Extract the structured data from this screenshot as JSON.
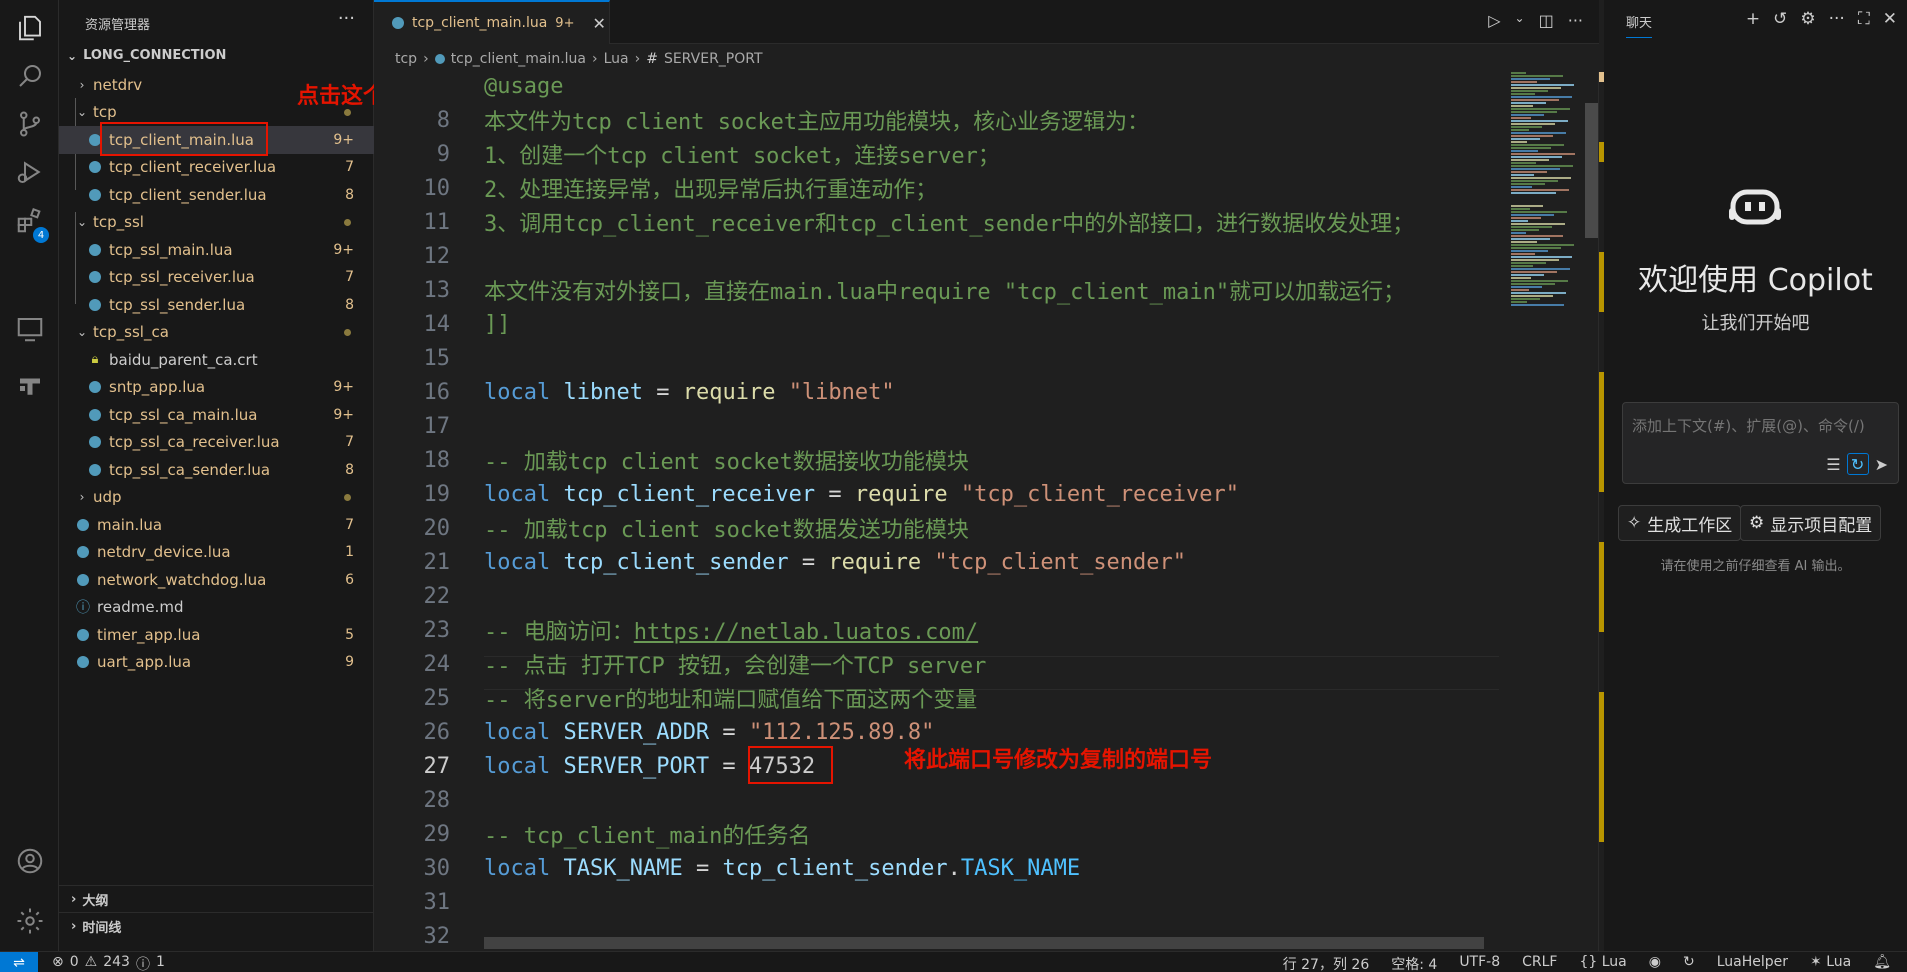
{
  "sidebar": {
    "title": "资源管理器",
    "more": "···",
    "project": "LONG_CONNECTION",
    "items": [
      {
        "label": "netdrv",
        "kind": "folder",
        "chev": "›",
        "badge": ""
      },
      {
        "label": "tcp",
        "kind": "folder",
        "chev": "⌄",
        "badge": ""
      },
      {
        "label": "tcp_client_main.lua",
        "kind": "lua",
        "badge": "9+"
      },
      {
        "label": "tcp_client_receiver.lua",
        "kind": "lua",
        "badge": "7"
      },
      {
        "label": "tcp_client_sender.lua",
        "kind": "lua",
        "badge": "8"
      },
      {
        "label": "tcp_ssl",
        "kind": "folder",
        "chev": "⌄",
        "badge": ""
      },
      {
        "label": "tcp_ssl_main.lua",
        "kind": "lua",
        "badge": "9+"
      },
      {
        "label": "tcp_ssl_receiver.lua",
        "kind": "lua",
        "badge": "7"
      },
      {
        "label": "tcp_ssl_sender.lua",
        "kind": "lua",
        "badge": "8"
      },
      {
        "label": "tcp_ssl_ca",
        "kind": "folder",
        "chev": "⌄",
        "badge": ""
      },
      {
        "label": "baidu_parent_ca.crt",
        "kind": "cert",
        "badge": ""
      },
      {
        "label": "sntp_app.lua",
        "kind": "lua",
        "badge": "9+"
      },
      {
        "label": "tcp_ssl_ca_main.lua",
        "kind": "lua",
        "badge": "9+"
      },
      {
        "label": "tcp_ssl_ca_receiver.lua",
        "kind": "lua",
        "badge": "7"
      },
      {
        "label": "tcp_ssl_ca_sender.lua",
        "kind": "lua",
        "badge": "8"
      },
      {
        "label": "udp",
        "kind": "folder",
        "chev": "›",
        "badge": ""
      },
      {
        "label": "main.lua",
        "kind": "lua",
        "badge": "7"
      },
      {
        "label": "netdrv_device.lua",
        "kind": "lua",
        "badge": "1"
      },
      {
        "label": "network_watchdog.lua",
        "kind": "lua",
        "badge": "6"
      },
      {
        "label": "readme.md",
        "kind": "info",
        "badge": ""
      },
      {
        "label": "timer_app.lua",
        "kind": "lua",
        "badge": "5"
      },
      {
        "label": "uart_app.lua",
        "kind": "lua",
        "badge": "9"
      }
    ],
    "outline": "大纲",
    "timeline": "时间线"
  },
  "annotations": {
    "click_file": "点击这个lua文件",
    "modify_port": "将此端口号修改为复制的端口号"
  },
  "editor": {
    "tab_label": "tcp_client_main.lua",
    "tab_badge": "9+",
    "breadcrumb": [
      "tcp",
      "tcp_client_main.lua",
      "Lua",
      "SERVER_PORT"
    ],
    "lines": [
      {
        "n": "",
        "parts": [
          [
            "c-cm",
            "@usage"
          ]
        ]
      },
      {
        "n": "8",
        "parts": [
          [
            "c-cm",
            "本文件为tcp client socket主应用功能模块，核心业务逻辑为："
          ]
        ]
      },
      {
        "n": "9",
        "parts": [
          [
            "c-cm",
            "1、创建一个tcp client socket，连接server；"
          ]
        ]
      },
      {
        "n": "10",
        "parts": [
          [
            "c-cm",
            "2、处理连接异常，出现异常后执行重连动作；"
          ]
        ]
      },
      {
        "n": "11",
        "parts": [
          [
            "c-cm",
            "3、调用tcp_client_receiver和tcp_client_sender中的外部接口，进行数据收发处理；"
          ]
        ]
      },
      {
        "n": "12",
        "parts": []
      },
      {
        "n": "13",
        "parts": [
          [
            "c-cm",
            "本文件没有对外接口，直接在main.lua中require \"tcp_client_main\"就可以加载运行；"
          ]
        ]
      },
      {
        "n": "14",
        "parts": [
          [
            "c-cm",
            "]]"
          ]
        ]
      },
      {
        "n": "15",
        "parts": []
      },
      {
        "n": "16",
        "parts": [
          [
            "c-kw",
            "local "
          ],
          [
            "c-id",
            "libnet"
          ],
          [
            "c-op",
            " = "
          ],
          [
            "c-fn",
            "require"
          ],
          [
            "c-op",
            " "
          ],
          [
            "c-st",
            "\"libnet\""
          ]
        ]
      },
      {
        "n": "17",
        "parts": []
      },
      {
        "n": "18",
        "parts": [
          [
            "c-cm",
            "-- 加载tcp client socket数据接收功能模块"
          ]
        ]
      },
      {
        "n": "19",
        "parts": [
          [
            "c-kw",
            "local "
          ],
          [
            "c-id",
            "tcp_client_receiver"
          ],
          [
            "c-op",
            " = "
          ],
          [
            "c-fn",
            "require"
          ],
          [
            "c-op",
            " "
          ],
          [
            "c-st",
            "\"tcp_client_receiver\""
          ]
        ]
      },
      {
        "n": "20",
        "parts": [
          [
            "c-cm",
            "-- 加载tcp client socket数据发送功能模块"
          ]
        ]
      },
      {
        "n": "21",
        "parts": [
          [
            "c-kw",
            "local "
          ],
          [
            "c-id",
            "tcp_client_sender"
          ],
          [
            "c-op",
            " = "
          ],
          [
            "c-fn",
            "require"
          ],
          [
            "c-op",
            " "
          ],
          [
            "c-st",
            "\"tcp_client_sender\""
          ]
        ]
      },
      {
        "n": "22",
        "parts": []
      },
      {
        "n": "23",
        "parts": [
          [
            "c-cm",
            "-- 电脑访问："
          ],
          [
            "c-cm-link",
            "https://netlab.luatos.com/"
          ]
        ]
      },
      {
        "n": "24",
        "parts": [
          [
            "c-cm",
            "-- 点击 打开TCP 按钮，会创建一个TCP server"
          ]
        ]
      },
      {
        "n": "25",
        "parts": [
          [
            "c-cm",
            "-- 将server的地址和端口赋值给下面这两个变量"
          ]
        ]
      },
      {
        "n": "26",
        "parts": [
          [
            "c-kw",
            "local "
          ],
          [
            "c-id",
            "SERVER_ADDR"
          ],
          [
            "c-op",
            " = "
          ],
          [
            "c-st",
            "\"112.125.89.8\""
          ]
        ]
      },
      {
        "n": "27",
        "parts": [
          [
            "c-kw",
            "local "
          ],
          [
            "c-id",
            "SERVER_PORT"
          ],
          [
            "c-op",
            " = "
          ],
          [
            "c-nm",
            "47532"
          ]
        ]
      },
      {
        "n": "28",
        "parts": []
      },
      {
        "n": "29",
        "parts": [
          [
            "c-cm",
            "-- tcp_client_main的任务名"
          ]
        ]
      },
      {
        "n": "30",
        "parts": [
          [
            "c-kw",
            "local "
          ],
          [
            "c-id",
            "TASK_NAME"
          ],
          [
            "c-op",
            " = "
          ],
          [
            "c-id",
            "tcp_client_sender"
          ],
          [
            "c-op",
            "."
          ],
          [
            "c-prop",
            "TASK_NAME"
          ]
        ]
      },
      {
        "n": "31",
        "parts": []
      },
      {
        "n": "32",
        "parts": []
      }
    ]
  },
  "chat": {
    "tab": "聊天",
    "welcome": "欢迎使用 Copilot",
    "subtitle": "让我们开始吧",
    "input_placeholder": "添加上下文(#)、扩展(@)、命令(/)",
    "btn_workspace": "生成工作区",
    "btn_config": "显示项目配置",
    "note": "请在使用之前仔细查看 AI 输出。"
  },
  "status": {
    "errors": "0",
    "warnings": "243",
    "info": "1",
    "position": "行 27，列 26",
    "spaces": "空格: 4",
    "encoding": "UTF-8",
    "eol": "CRLF",
    "language": "Lua",
    "helper": "LuaHelper",
    "lang2": "Lua"
  }
}
